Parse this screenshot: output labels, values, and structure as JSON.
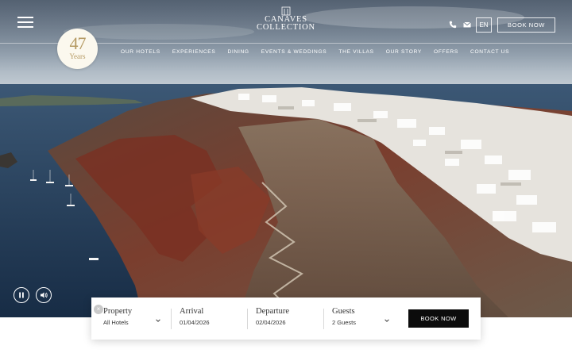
{
  "brand": {
    "line1": "CANAVES",
    "line2": "COLLECTION"
  },
  "header": {
    "language": "EN",
    "book_now": "BOOK NOW"
  },
  "badge": {
    "number": "47",
    "label": "Years"
  },
  "nav": [
    {
      "label": "OUR HOTELS"
    },
    {
      "label": "EXPERIENCES"
    },
    {
      "label": "DINING"
    },
    {
      "label": "EVENTS & WEDDINGS"
    },
    {
      "label": "THE VILLAS"
    },
    {
      "label": "OUR STORY"
    },
    {
      "label": "OFFERS"
    },
    {
      "label": "CONTACT US"
    }
  ],
  "booking": {
    "property": {
      "label": "Property",
      "value": "All Hotels"
    },
    "arrival": {
      "label": "Arrival",
      "value": "01/04/2026"
    },
    "departure": {
      "label": "Departure",
      "value": "02/04/2026"
    },
    "guests": {
      "label": "Guests",
      "value": "2 Guests"
    },
    "submit": "BOOK NOW",
    "close": "×"
  },
  "icons": {
    "menu": "hamburger-icon",
    "phone": "phone-icon",
    "mail": "mail-icon",
    "pause": "pause-icon",
    "volume": "volume-icon"
  },
  "colors": {
    "badge_bg": "#fbf8ee",
    "badge_gold": "#b59a63",
    "cta": "#0c0c0c",
    "sea": "#223a56",
    "cliff": "#6a3a2c"
  }
}
